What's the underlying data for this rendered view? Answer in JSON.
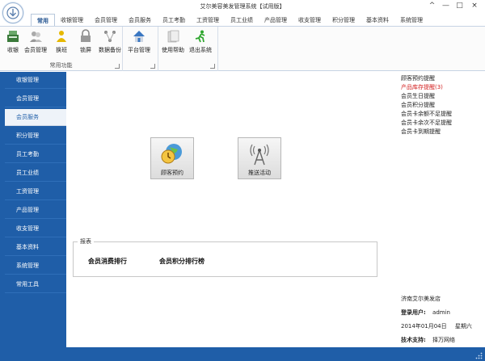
{
  "window": {
    "title": "艾尔美容美发管理系统【试用版】",
    "buttons": [
      "^",
      "—",
      "□",
      "×"
    ]
  },
  "tabs": [
    {
      "label": "常用",
      "active": true
    },
    {
      "label": "收银管理"
    },
    {
      "label": "会员管理"
    },
    {
      "label": "会员服务"
    },
    {
      "label": "员工考勤"
    },
    {
      "label": "工资管理"
    },
    {
      "label": "员工业绩"
    },
    {
      "label": "产品管理"
    },
    {
      "label": "收支管理"
    },
    {
      "label": "积分管理"
    },
    {
      "label": "基本资料"
    },
    {
      "label": "系统管理"
    }
  ],
  "ribbon": {
    "group1": {
      "title": "常用功能",
      "buttons": [
        "收银",
        "会员管理",
        "换班",
        "锁屏",
        "数据备份"
      ]
    },
    "group2": {
      "title": "",
      "buttons": [
        "平台管理"
      ]
    },
    "group3": {
      "title": "",
      "buttons": [
        "使用帮助",
        "退出系统"
      ]
    }
  },
  "sidebar": {
    "items": [
      {
        "label": "收银管理"
      },
      {
        "label": "会员管理"
      },
      {
        "label": "会员服务",
        "active": true
      },
      {
        "label": "积分管理"
      },
      {
        "label": "员工考勤"
      },
      {
        "label": "员工业绩"
      },
      {
        "label": "工资管理"
      },
      {
        "label": "产品管理"
      },
      {
        "label": "收支管理"
      },
      {
        "label": "基本资料"
      },
      {
        "label": "系统管理"
      },
      {
        "label": "常用工具"
      }
    ]
  },
  "main": {
    "buttons": [
      "顾客预约",
      "推送活动"
    ],
    "reminders": [
      {
        "label": "顾客预约提醒"
      },
      {
        "label": "产品库存提醒(3)",
        "alert": true
      },
      {
        "label": "会员生日提醒"
      },
      {
        "label": "会员积分提醒"
      },
      {
        "label": "会员卡余额不足提醒"
      },
      {
        "label": "会员卡余次不足提醒"
      },
      {
        "label": "会员卡到期提醒"
      }
    ],
    "report": {
      "legend": "报表",
      "links": [
        "会员消费排行",
        "会员积分排行榜"
      ]
    },
    "info": {
      "store": "济南艾尔美发店",
      "user_key": "登录用户:",
      "user_value": "admin",
      "date": "2014年01月04日",
      "weekday": "星期六",
      "support_key": "技术支持:",
      "support_value": "择万网络"
    }
  },
  "colors": {
    "sidebar": "#1f5ea8",
    "alert": "#d32222",
    "statusbar": "#1f5ea8"
  }
}
